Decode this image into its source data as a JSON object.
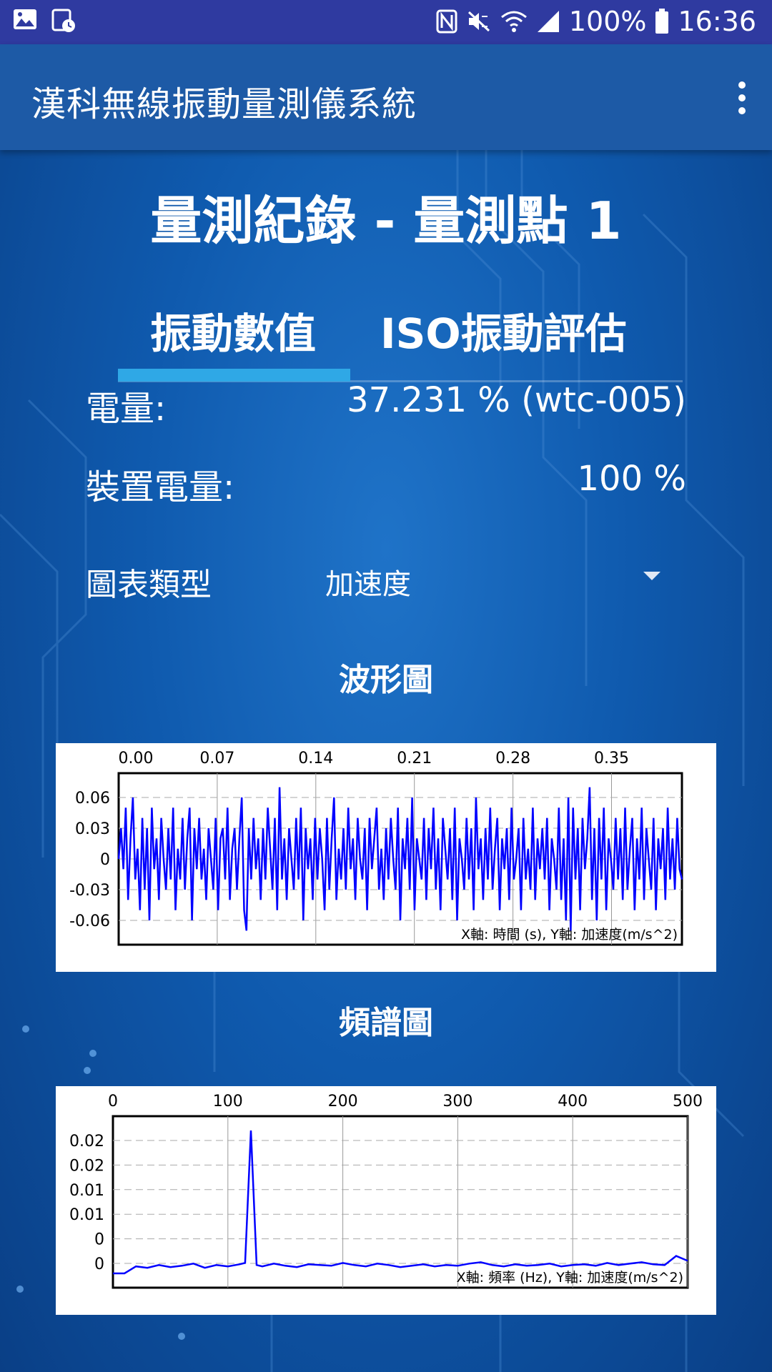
{
  "status_bar": {
    "battery": "100%",
    "time": "16:36"
  },
  "app_bar": {
    "title": "漢科無線振動量測儀系統"
  },
  "page_title": "量測紀錄 - 量測點 1",
  "tabs": [
    {
      "label": "振動數值",
      "active": true
    },
    {
      "label": "ISO振動評估",
      "active": false
    }
  ],
  "info": {
    "power_label": "電量:",
    "power_value": "37.231 % (wtc-005)",
    "device_power_label": "裝置電量:",
    "device_power_value": "100 %"
  },
  "chart_type": {
    "label": "圖表類型",
    "selected": "加速度"
  },
  "colors": {
    "accent": "#2fa8e6",
    "trace": "#0000ff"
  },
  "icons": [
    "image-icon",
    "calendar-clock-icon",
    "nfc-icon",
    "mute-icon",
    "wifi-icon",
    "signal-icon",
    "battery-icon",
    "more-vert-icon",
    "dropdown-arrow-icon"
  ],
  "waveform": {
    "title": "波形圖",
    "chart_data": {
      "type": "line",
      "x_ticks": [
        "0.00",
        "0.07",
        "0.14",
        "0.21",
        "0.28",
        "0.35"
      ],
      "y_ticks": [
        "0.06",
        "0.03",
        "0",
        "-0.03",
        "-0.06"
      ],
      "xlim": [
        0,
        0.4
      ],
      "ylim": [
        -0.08,
        0.08
      ],
      "grid": true,
      "annotation": "X軸: 時間 (s), Y軸: 加速度(m/s^2)",
      "values": [
        0.0,
        0.03,
        -0.01,
        0.05,
        -0.04,
        0.02,
        0.06,
        -0.02,
        0.01,
        -0.05,
        0.04,
        -0.03,
        0.03,
        -0.06,
        0.05,
        -0.01,
        0.02,
        -0.04,
        0.04,
        0.0,
        -0.03,
        0.03,
        -0.02,
        0.05,
        -0.05,
        0.01,
        -0.02,
        0.04,
        -0.03,
        0.02,
        0.05,
        -0.06,
        0.03,
        -0.01,
        0.04,
        -0.02,
        0.01,
        -0.04,
        0.03,
        0.0,
        -0.03,
        0.04,
        -0.05,
        0.02,
        0.03,
        -0.02,
        0.05,
        -0.04,
        0.01,
        0.03,
        -0.03,
        0.02,
        0.06,
        -0.05,
        -0.07,
        0.03,
        -0.02,
        0.04,
        -0.01,
        0.02,
        -0.04,
        0.03,
        -0.02,
        0.05,
        0.01,
        -0.03,
        0.04,
        -0.05,
        0.07,
        -0.02,
        0.02,
        -0.04,
        0.03,
        0.0,
        -0.03,
        0.04,
        -0.02,
        0.05,
        -0.06,
        0.03,
        -0.01,
        0.02,
        -0.04,
        0.04,
        -0.02,
        0.03,
        0.0,
        -0.05,
        0.04,
        -0.03,
        0.02,
        0.06,
        -0.04,
        0.01,
        -0.02,
        0.03,
        -0.03,
        0.05,
        -0.01,
        0.02,
        -0.04,
        0.04,
        0.0,
        -0.02,
        0.03,
        -0.05,
        0.04,
        -0.01,
        0.02,
        0.05,
        -0.03,
        0.01,
        -0.04,
        0.03,
        -0.02,
        0.04,
        0.0,
        -0.03,
        0.05,
        -0.06,
        0.02,
        -0.01,
        0.04,
        -0.03,
        0.06,
        -0.05,
        0.02,
        0.0,
        -0.02,
        0.04,
        -0.04,
        0.03,
        -0.01,
        0.05,
        -0.03,
        0.02,
        -0.05,
        0.04,
        0.01,
        -0.02,
        0.03,
        -0.04,
        0.05,
        -0.06,
        0.02,
        0.0,
        -0.03,
        0.04,
        -0.02,
        0.03,
        -0.05,
        0.06,
        -0.01,
        0.02,
        -0.04,
        0.03,
        -0.02,
        0.05,
        -0.03,
        0.01,
        0.04,
        -0.05,
        0.02,
        -0.01,
        0.03,
        -0.04,
        0.05,
        -0.02,
        0.0,
        0.03,
        -0.05,
        0.04,
        -0.02,
        0.01,
        -0.03,
        0.05,
        -0.04,
        0.02,
        -0.01,
        0.03,
        -0.02,
        0.04,
        -0.05,
        0.02,
        0.0,
        -0.03,
        0.05,
        -0.04,
        0.02,
        -0.06,
        0.06,
        -0.07,
        0.05,
        -0.02,
        0.03,
        -0.05,
        0.04,
        -0.01,
        0.02,
        0.07,
        -0.04,
        0.03,
        -0.06,
        0.04,
        -0.02,
        0.05,
        -0.05,
        0.02,
        0.0,
        -0.03,
        0.04,
        -0.02,
        0.03,
        -0.04,
        0.05,
        -0.03,
        0.01,
        0.04,
        -0.05,
        0.02,
        -0.02,
        0.05,
        -0.04,
        0.03,
        0.0,
        -0.03,
        0.04,
        -0.05,
        0.02,
        -0.01,
        0.03,
        -0.04,
        0.05,
        -0.02,
        0.02,
        -0.03,
        0.04,
        -0.01,
        -0.02
      ]
    }
  },
  "spectrum": {
    "title": "頻譜圖",
    "chart_data": {
      "type": "line",
      "x_ticks": [
        "0",
        "100",
        "200",
        "300",
        "400",
        "500"
      ],
      "y_ticks": [
        "0.02",
        "0.02",
        "0.01",
        "0.01",
        "0",
        "0"
      ],
      "xlim": [
        0,
        500
      ],
      "ylim": [
        -0.0005,
        0.025
      ],
      "grid": true,
      "annotation": "X軸: 頻率 (Hz), Y軸: 加速度(m/s^2)",
      "x": [
        0,
        10,
        20,
        30,
        40,
        50,
        60,
        70,
        80,
        90,
        100,
        110,
        115,
        120,
        125,
        130,
        140,
        150,
        160,
        170,
        180,
        190,
        200,
        210,
        220,
        230,
        240,
        250,
        260,
        270,
        280,
        290,
        300,
        310,
        320,
        330,
        340,
        350,
        360,
        370,
        380,
        390,
        400,
        410,
        420,
        430,
        440,
        450,
        460,
        470,
        480,
        490,
        500
      ],
      "values": [
        0.0,
        0.0,
        0.001,
        0.0008,
        0.0012,
        0.0009,
        0.0011,
        0.0014,
        0.0008,
        0.0012,
        0.001,
        0.0013,
        0.0015,
        0.0205,
        0.0012,
        0.001,
        0.0014,
        0.0011,
        0.0009,
        0.0013,
        0.0012,
        0.0011,
        0.0015,
        0.0012,
        0.001,
        0.0014,
        0.0012,
        0.0009,
        0.0011,
        0.0013,
        0.001,
        0.0012,
        0.0011,
        0.0014,
        0.0016,
        0.0012,
        0.001,
        0.0013,
        0.0011,
        0.0012,
        0.0014,
        0.001,
        0.0012,
        0.0013,
        0.0011,
        0.0015,
        0.0012,
        0.0014,
        0.0016,
        0.0013,
        0.0012,
        0.0025,
        0.0018
      ]
    }
  }
}
